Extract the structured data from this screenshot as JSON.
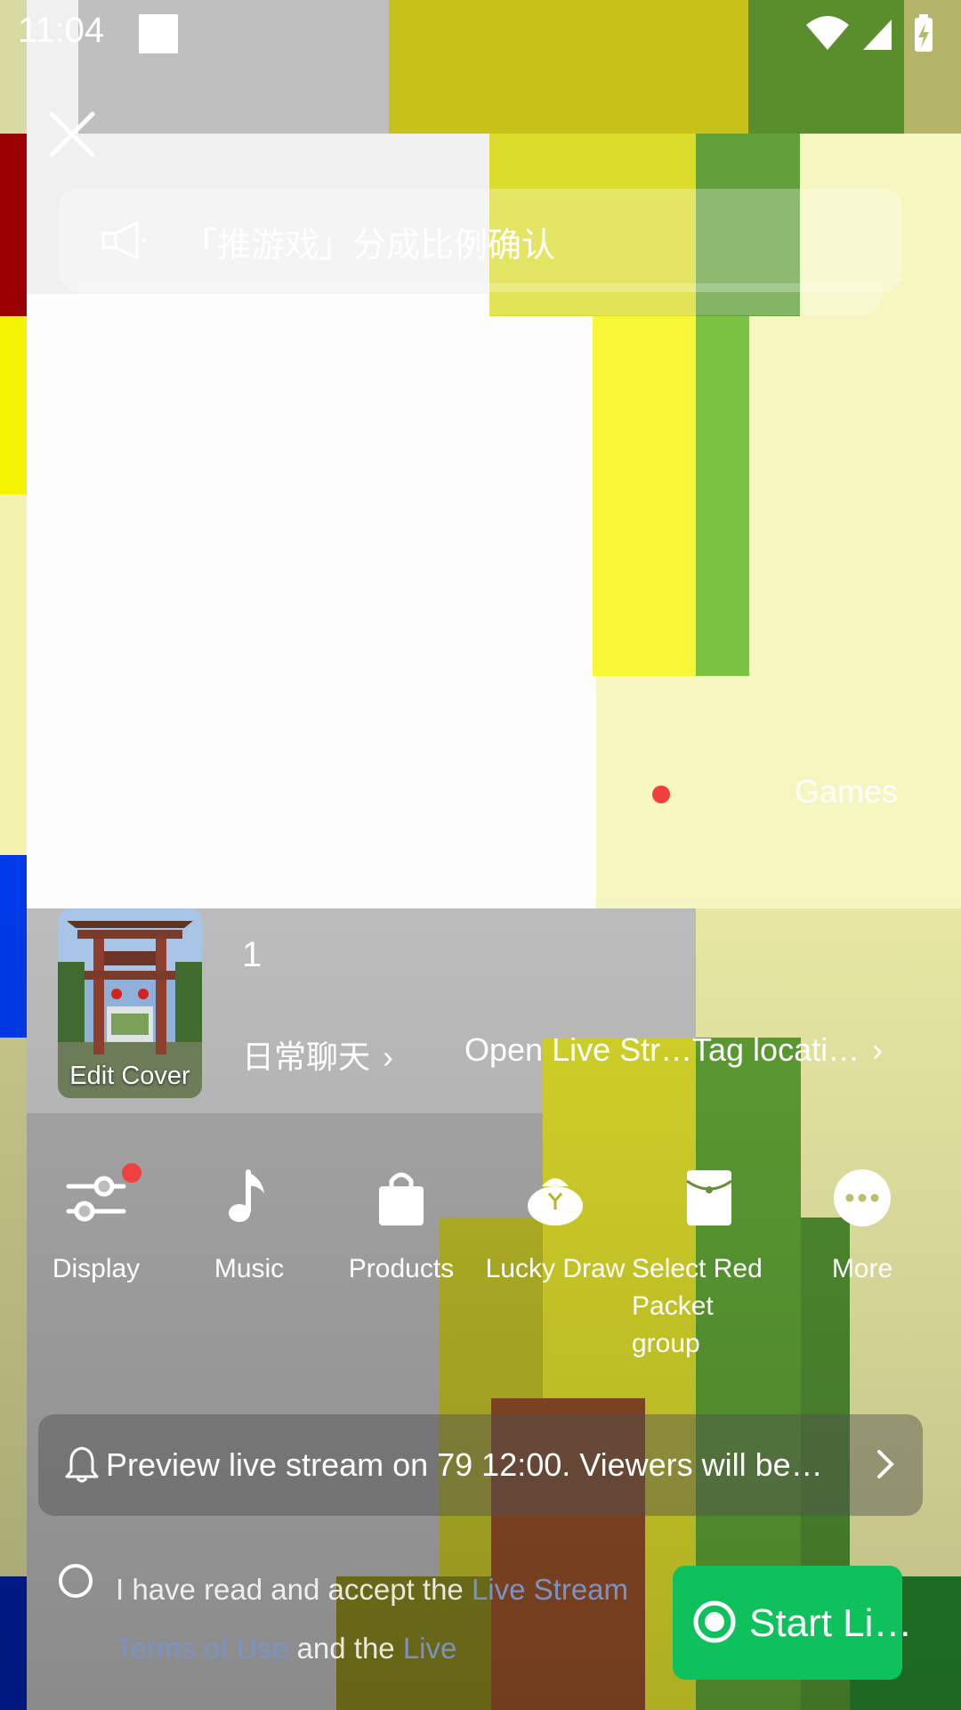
{
  "status_bar": {
    "time": "11:04"
  },
  "notice": {
    "icon": "megaphone-icon",
    "text": "「推游戏」分成比例确认"
  },
  "category": {
    "label": "Games"
  },
  "cover": {
    "label": "Edit Cover"
  },
  "stream_title": "1",
  "info_row": {
    "category_tag": "日常聊天",
    "open_live": "Open Live Str…",
    "tag_location": "Tag locati…"
  },
  "tools": [
    {
      "icon": "display-sliders-icon",
      "label": "Display"
    },
    {
      "icon": "music-note-icon",
      "label": "Music"
    },
    {
      "icon": "shopping-bag-icon",
      "label": "Products"
    },
    {
      "icon": "lucky-bag-icon",
      "label": "Lucky Draw"
    },
    {
      "icon": "red-packet-icon",
      "label": "Select Red Packet group"
    },
    {
      "icon": "more-dots-icon",
      "label": "More"
    }
  ],
  "preview": {
    "icon": "bell-icon",
    "text": "Preview live stream on 79 12:00. Viewers will be…"
  },
  "agreement": {
    "prefix": "I have read and accept the ",
    "link1": "Live Stream Terms of Use",
    "middle": " and the ",
    "link2": "Live"
  },
  "start_button": {
    "label": "Start Li…"
  },
  "colors": {
    "start_green": "#0fc15c",
    "link_blue": "#7b93c4",
    "badge_red": "#f04040"
  }
}
